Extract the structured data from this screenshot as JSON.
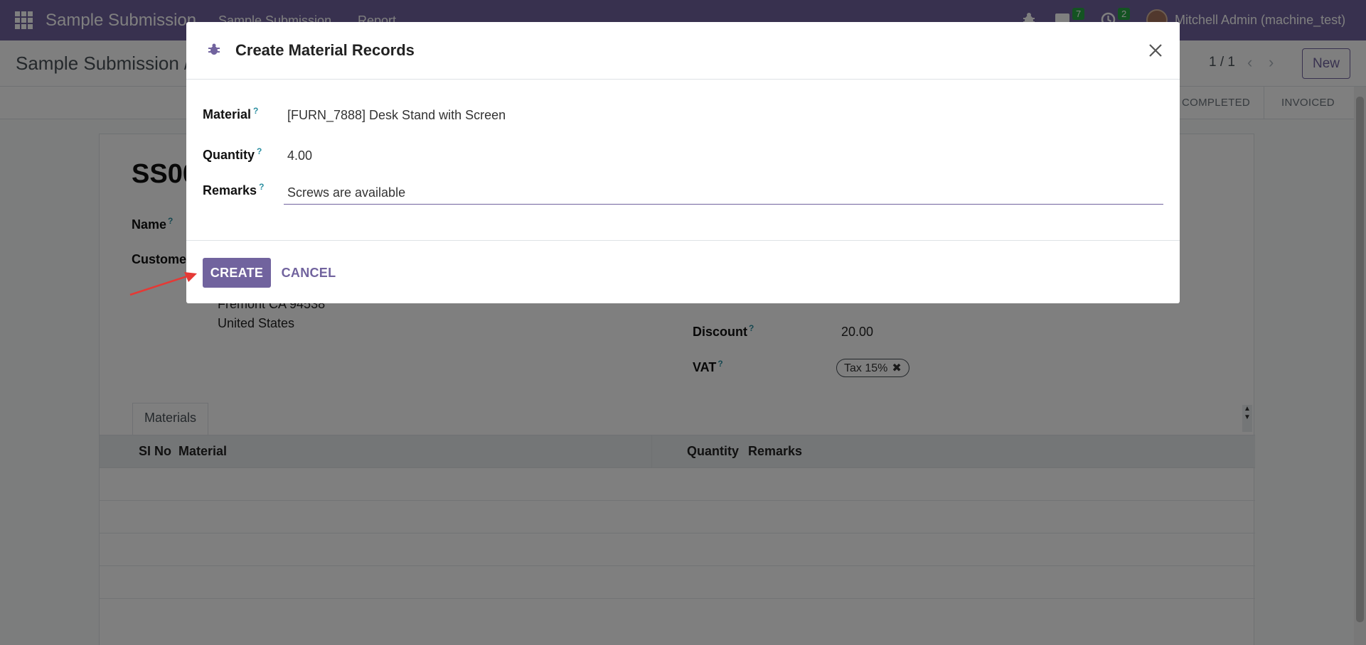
{
  "navbar": {
    "brand": "Sample Submission",
    "menu": [
      "Sample Submission",
      "Report"
    ],
    "messages_count": "7",
    "activities_count": "2",
    "user": "Mitchell Admin (machine_test)"
  },
  "control_panel": {
    "breadcrumb": "Sample Submission /",
    "pager": "1 / 1",
    "new_label": "New"
  },
  "statusbar": {
    "stages": [
      "COMPLETED",
      "INVOICED"
    ]
  },
  "form": {
    "record_title": "SS00",
    "name_label": "Name",
    "customer_label": "Custome",
    "address_line1": "Fremont CA 94538",
    "address_line2": "United States",
    "discount_label": "Discount",
    "discount_value": "20.00",
    "vat_label": "VAT",
    "vat_tag": "Tax 15%",
    "tab_label": "Materials",
    "columns": [
      "SI No",
      "Material",
      "Quantity",
      "Remarks"
    ]
  },
  "modal": {
    "title": "Create Material Records",
    "material_label": "Material",
    "material_value": "[FURN_7888] Desk Stand with Screen",
    "quantity_label": "Quantity",
    "quantity_value": "4.00",
    "remarks_label": "Remarks",
    "remarks_value": "Screws are available",
    "help_mark": "?",
    "create_label": "CREATE",
    "cancel_label": "CANCEL"
  },
  "colors": {
    "brand": "#71639e",
    "badge": "#28a745",
    "annotation_arrow": "#e53935"
  }
}
